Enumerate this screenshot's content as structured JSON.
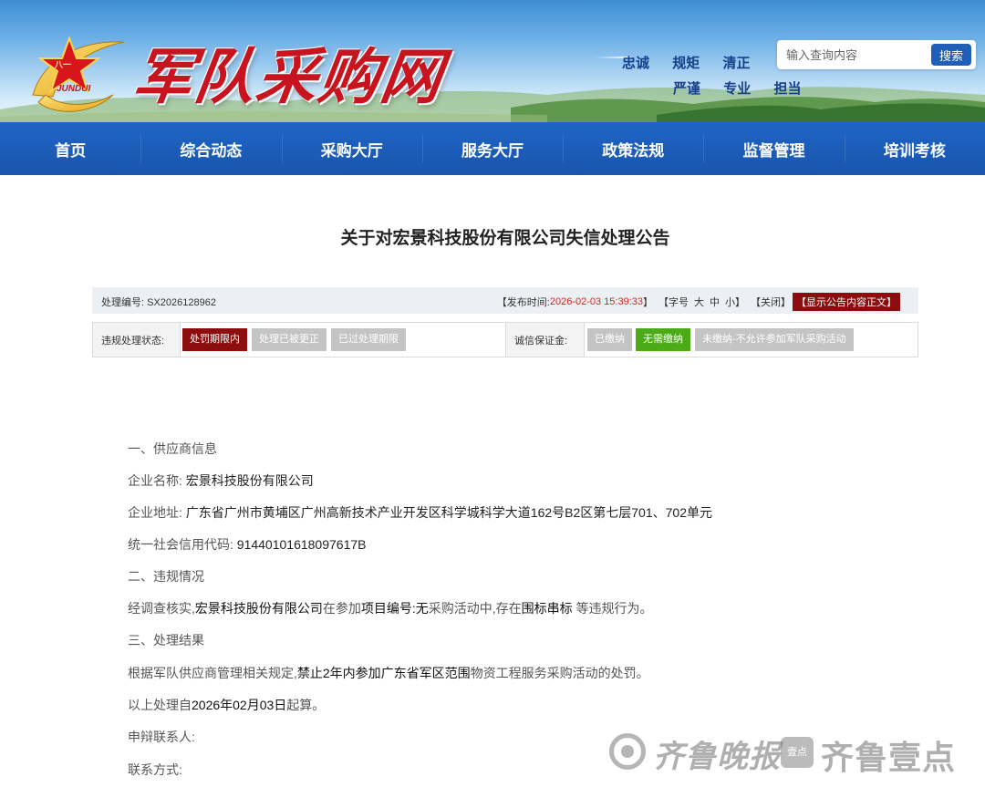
{
  "header": {
    "logo_text": "军队采购网",
    "logo_emblem_text": "JUNDUI",
    "emblem_star_text": "八一",
    "slogans_row1": [
      "忠诚",
      "规矩",
      "清正"
    ],
    "slogans_row2": [
      "严谨",
      "专业",
      "担当"
    ],
    "search": {
      "placeholder": "输入查询内容",
      "button_label": "搜索"
    }
  },
  "nav": {
    "items": [
      "首页",
      "综合动态",
      "采购大厅",
      "服务大厅",
      "政策法规",
      "监督管理",
      "培训考核"
    ]
  },
  "notice": {
    "title": "关于对宏景科技股份有限公司失信处理公告",
    "meta": {
      "number_label": "处理编号:",
      "number_value": "SX2026128962",
      "publish_label": "【发布时间:",
      "publish_value": "2026-02-03 15:39:33",
      "publish_close": "】",
      "font_size_label": "【字号",
      "font_large": "大",
      "font_medium": "中",
      "font_small": "小",
      "font_close": "】",
      "close_label": "【关闭】",
      "show_label": "【显示公告内容正文】"
    },
    "status": {
      "violation_label": "违规处理状态:",
      "violation_tags": [
        "处罚期限内",
        "处理已被更正",
        "已过处理期限"
      ],
      "deposit_label": "诚信保证金:",
      "deposit_tags": [
        "已缴纳",
        "无需缴纳",
        "未缴纳-不允许参加军队采购活动"
      ]
    },
    "body": {
      "section1": "一、供应商信息",
      "company_label": "企业名称:",
      "company_value": "宏景科技股份有限公司",
      "address_label": "企业地址:",
      "address_value": "广东省广州市黄埔区广州高新技术产业开发区科学城科学大道162号B2区第七层701、702单元",
      "credit_label": "统一社会信用代码:",
      "credit_value": "91440101618097617B",
      "section2": "二、违规情况",
      "violation_p1": "经调查核实,",
      "violation_company": "宏景科技股份有限公司",
      "violation_p2": "在参加",
      "violation_p3": "项目编号:无",
      "violation_p4": "采购活动中,存在",
      "violation_p5": "围标串标",
      "violation_p6": " 等违规行为。",
      "section3": "三、处理结果",
      "result_p1": "根据军队供应商管理相关规定,",
      "result_p2": "禁止2年内参加广东省军区范围",
      "result_p3": "物资工程服务采购活动的处罚。",
      "start_p1": "以上处理自",
      "start_p2": "2026年02月03日",
      "start_p3": "起算。",
      "contact_person_label": "申辩联系人:",
      "contact_method_label": "联系方式:"
    }
  },
  "watermark": {
    "text1": "齐鲁晚报",
    "box_text": "壹点",
    "text2": "齐鲁壹点"
  },
  "colors": {
    "nav_blue": "#1a56ae",
    "tag_red": "#8b0d0d",
    "tag_green": "#4aab16",
    "tag_gray": "#c4c4c4",
    "logo_red": "#c8141e",
    "date_red": "#d4271e"
  }
}
